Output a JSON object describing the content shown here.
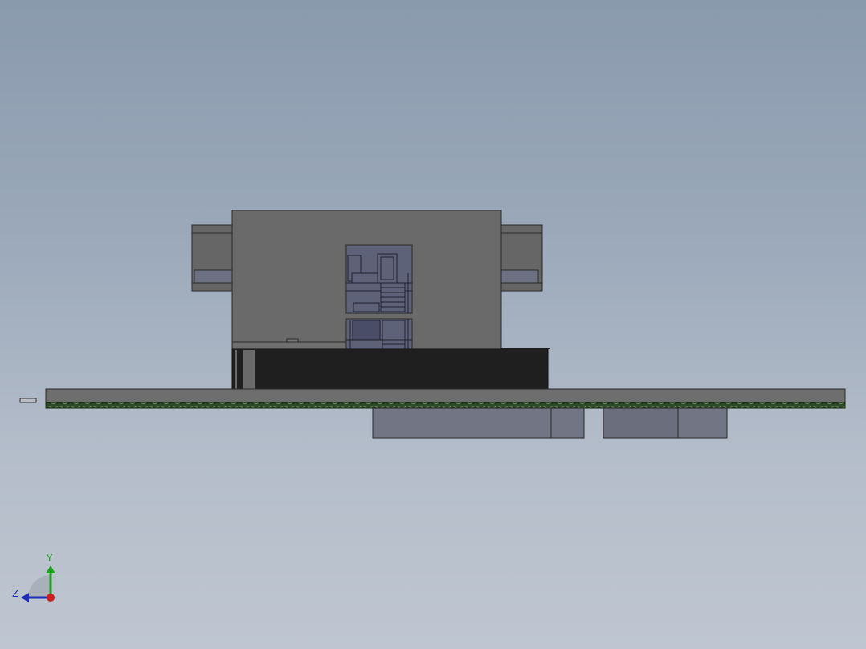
{
  "viewport": {
    "background_top": "#8a9aad",
    "background_bottom": "#bfc6d1"
  },
  "model": {
    "body_color": "#6b6b6b",
    "body_dark": "#1f1f1f",
    "bracket_color": "#666666",
    "plate_color": "#6e6e6e",
    "pcb_color": "#2f4a2a",
    "lower_block_color": "#717584",
    "window_color": "#5d6078"
  },
  "triad": {
    "y_label": "Y",
    "z_label": "Z",
    "y_color": "#1aa31a",
    "z_color": "#1f2fb8",
    "x_color": "#cc1f1f",
    "y_icon": "y-axis-arrow-icon",
    "z_icon": "z-axis-arrow-icon",
    "x_icon": "x-axis-origin-icon"
  }
}
